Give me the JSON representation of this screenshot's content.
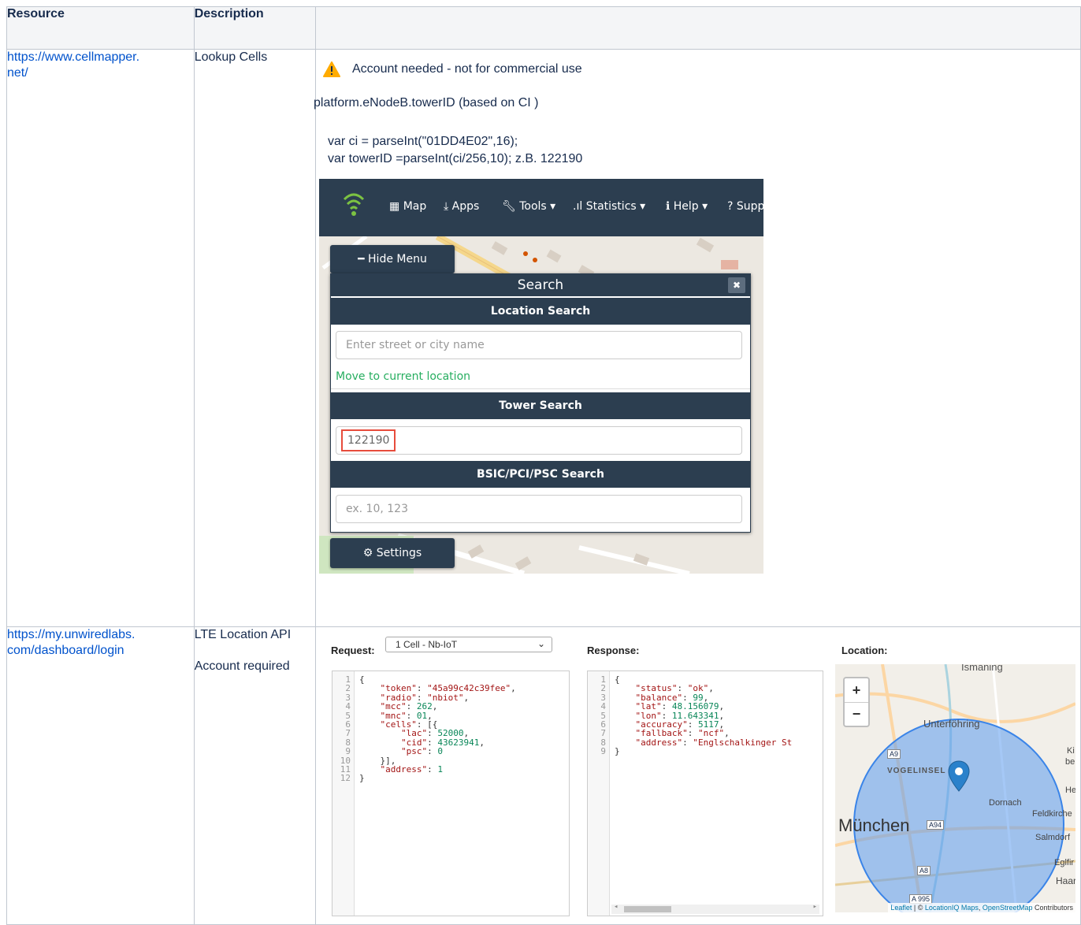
{
  "table": {
    "headers": [
      "Resource",
      "Description",
      ""
    ]
  },
  "row1": {
    "resource": "https://www.cellmapper.\nnet/",
    "description": "Lookup Cells",
    "warning": "Account needed - not for commercial use",
    "formula_label": "platform.eNodeB.towerID (based on CI )",
    "code_line1": "var ci = parseInt(\"01DD4E02\",16);",
    "code_line2": "var towerID =parseInt(ci/256,10);  z.B. 122190",
    "screenshot": {
      "nav": {
        "map": "Map",
        "apps": "Apps",
        "tools": "Tools ▾",
        "statistics": "Statistics ▾",
        "help": "Help ▾",
        "support": "Supp"
      },
      "hide_menu": "Hide Menu",
      "search_title": "Search",
      "close": "✖",
      "location_search": "Location Search",
      "location_placeholder": "Enter street or city name",
      "move_current": "Move to current location",
      "tower_search": "Tower Search",
      "tower_value": "122190",
      "bsic_search": "BSIC/PCI/PSC Search",
      "bsic_placeholder": "ex. 10, 123",
      "settings": "Settings"
    }
  },
  "row2": {
    "resource": "https://my.unwiredlabs.\ncom/dashboard/login",
    "description_line1": "LTE Location API",
    "description_line2": "Account required",
    "request_label": "Request:",
    "request_select": "1 Cell - Nb-IoT",
    "response_label": "Response:",
    "location_label": "Location:",
    "request_code": [
      "{",
      "    \"token\": \"45a99c42c39fee\",",
      "    \"radio\": \"nbiot\",",
      "    \"mcc\": 262,",
      "    \"mnc\": 01,",
      "    \"cells\": [{",
      "        \"lac\": 52000,",
      "        \"cid\": 43623941,",
      "        \"psc\": 0",
      "    }],",
      "    \"address\": 1",
      "}"
    ],
    "response_code": [
      "{",
      "    \"status\": \"ok\",",
      "    \"balance\": 99,",
      "    \"lat\": 48.156079,",
      "    \"lon\": 11.643341,",
      "    \"accuracy\": 5117,",
      "    \"fallback\": \"ncf\",",
      "    \"address\": \"Englschalkinger St",
      "}"
    ],
    "map": {
      "zoom_in": "+",
      "zoom_out": "−",
      "places": {
        "ismaning": "Ismaning",
        "unterfoehring": "Unterföhring",
        "vogelinsel": "VOGELINSEL",
        "dornach": "Dornach",
        "muenchen": "München",
        "feldkirchen": "Feldkirche",
        "salmdorf": "Salmdorf",
        "eglfing": "Eglfir",
        "haar": "Haar",
        "ki": "Ki",
        "bel": "bel",
        "hei": "Hei"
      },
      "roads": {
        "a9": "A9",
        "a94": "A94",
        "a8": "A8",
        "a995": "A 995"
      },
      "attribution_leaflet": "Leaflet",
      "attribution_rest": " | © ",
      "attribution_liq": "LocationIQ Maps",
      "attribution_sep": ", ",
      "attribution_osm": "OpenStreetMap",
      "attribution_tail": " Contributors"
    }
  },
  "colors": {
    "link": "#0052cc",
    "nav": "#2c3e50",
    "warning": "#ffab00",
    "accent_green": "#27ae60"
  }
}
